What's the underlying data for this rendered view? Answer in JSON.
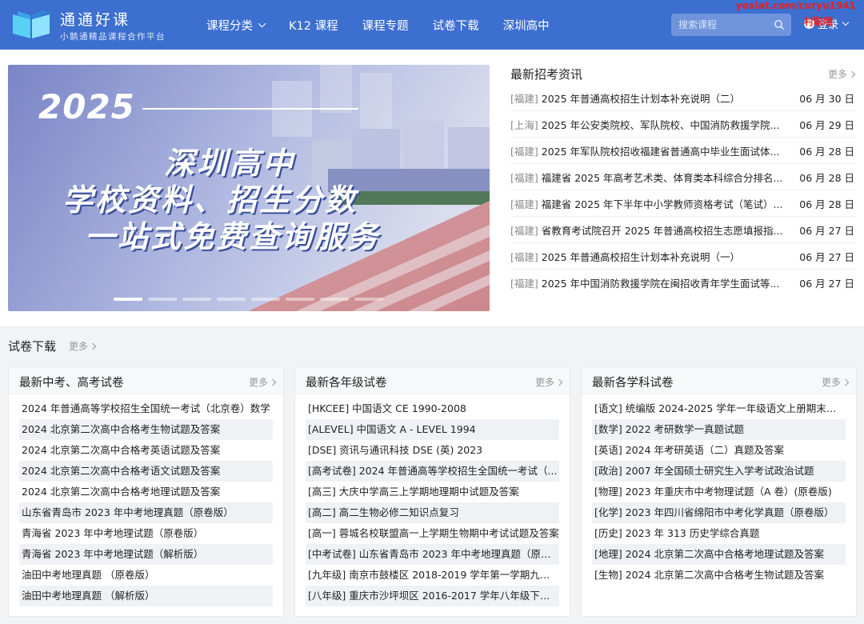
{
  "watermark": {
    "line1": "yoxiat.com/curyu1941",
    "line2": "村聪哦"
  },
  "header": {
    "title": "通通好课",
    "subtitle": "小鹅通精品课程合作平台",
    "nav": [
      {
        "label": "课程分类",
        "has_dropdown": true
      },
      {
        "label": "K12 课程"
      },
      {
        "label": "课程专题"
      },
      {
        "label": "试卷下载"
      },
      {
        "label": "深圳高中"
      }
    ],
    "search": {
      "placeholder": "搜索课程"
    },
    "login_label": "登录"
  },
  "banner": {
    "year": "2025",
    "line1": "深圳高中",
    "line2": "学校资料、招生分数",
    "line3": "一站式免费查询服务",
    "slide_count": 8,
    "active_slide": 1
  },
  "news": {
    "title": "最新招考资讯",
    "more": "更多",
    "items": [
      {
        "tag": "[福建]",
        "text": "2025 年普通高校招生计划本补充说明（二）",
        "date": "06 月 30 日"
      },
      {
        "tag": "[上海]",
        "text": "2025 年公安类院校、军队院校、中国消防救援学院...",
        "date": "06 月 29 日"
      },
      {
        "tag": "[福建]",
        "text": "2025 年军队院校招收福建省普通高中毕业生面试体...",
        "date": "06 月 28 日"
      },
      {
        "tag": "[福建]",
        "text": "福建省 2025 年高考艺术类、体育类本科综合分排名...",
        "date": "06 月 28 日"
      },
      {
        "tag": "[福建]",
        "text": "福建省 2025 年下半年中小学教师资格考试（笔试）...",
        "date": "06 月 28 日"
      },
      {
        "tag": "[福建]",
        "text": "省教育考试院召开 2025 年普通高校招生志愿填报指...",
        "date": "06 月 27 日"
      },
      {
        "tag": "[福建]",
        "text": "2025 年普通高校招生计划本补充说明（一）",
        "date": "06 月 27 日"
      },
      {
        "tag": "[福建]",
        "text": "2025 年中国消防救援学院在闽招收青年学生面试等...",
        "date": "06 月 27 日"
      }
    ]
  },
  "papers": {
    "title": "试卷下载",
    "more": "更多",
    "cards": [
      {
        "title": "最新中考、高考试卷",
        "more": "更多",
        "items": [
          "2024 年普通高等学校招生全国统一考试（北京卷）数学",
          "2024 北京第二次高中合格考生物试题及答案",
          "2024 北京第二次高中合格考英语试题及答案",
          "2024 北京第二次高中合格考语文试题及答案",
          "2024 北京第二次高中合格考地理试题及答案",
          "山东省青岛市 2023 年中考地理真题（原卷版）",
          "青海省 2023 年中考地理试题（原卷版）",
          "青海省 2023 年中考地理试题（解析版）",
          "油田中考地理真题 （原卷版）",
          "油田中考地理真题 （解析版）"
        ]
      },
      {
        "title": "最新各年级试卷",
        "more": "更多",
        "items": [
          "[HKCEE] 中国语文 CE 1990-2008",
          "[ALEVEL] 中国语文 A - LEVEL 1994",
          "[DSE] 资讯与通讯科技 DSE (英) 2023",
          "[高考试卷] 2024 年普通高等学校招生全国统一考试（...",
          "[高三] 大庆中学高三上学期地理期中试题及答案",
          "[高二] 高二生物必修二知识点复习",
          "[高一] 蓉城名校联盟高一上学期生物期中考试试题及答案",
          "[中考试卷] 山东省青岛市 2023 年中考地理真题（原卷...",
          "[九年级] 南京市鼓楼区 2018-2019 学年第一学期九年...",
          "[八年级] 重庆市沙坪坝区 2016-2017 学年八年级下期..."
        ]
      },
      {
        "title": "最新各学科试卷",
        "more": "更多",
        "items": [
          "[语文] 统编版 2024-2025 学年一年级语文上册期末末...",
          "[数学] 2022 考研数学一真题试题",
          "[英语] 2024 年考研英语（二）真题及答案",
          "[政治] 2007 年全国硕士研究生入学考试政治试题",
          "[物理] 2023 年重庆市中考物理试题（A 卷）(原卷版)",
          "[化学] 2023 年四川省绵阳市中考化学真题（原卷版）",
          "[历史] 2023 年 313 历史学综合真题",
          "[地理] 2024 北京第二次高中合格考地理试题及答案",
          "[生物] 2024 北京第二次高中合格考生物试题及答案"
        ]
      }
    ]
  },
  "colors": {
    "header_bg": "#3c6fd0",
    "search_bg": "#6f94dc"
  }
}
